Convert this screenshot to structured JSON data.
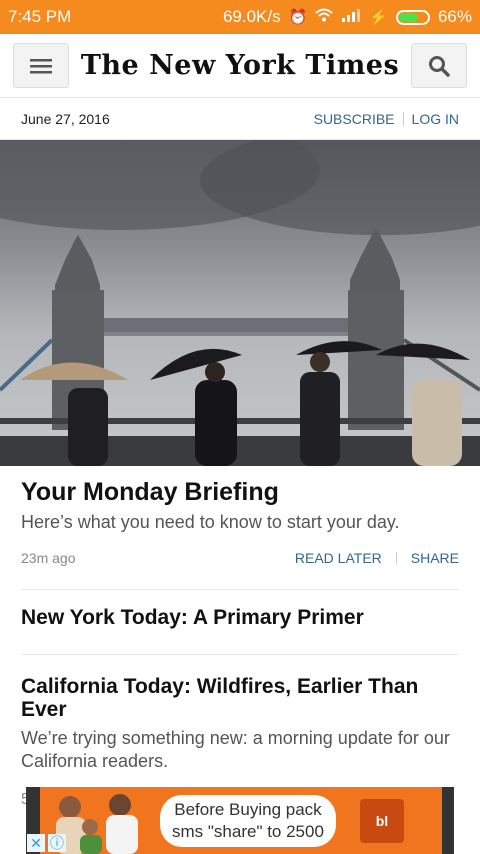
{
  "statusbar": {
    "time": "7:45 PM",
    "speed": "69.0K/s",
    "battery": "66%",
    "icons": [
      "alarm-icon",
      "wifi-icon",
      "signal-icon",
      "charging-icon"
    ]
  },
  "header": {
    "masthead": "The New York Times",
    "menu_icon": "hamburger-menu-icon",
    "search_icon": "search-icon"
  },
  "daterow": {
    "date": "June 27, 2016",
    "subscribe": "SUBSCRIBE",
    "login": "LOG IN"
  },
  "articles": [
    {
      "headline": "Your Monday Briefing",
      "summary": "Here’s what you need to know to start your day.",
      "time": "23m ago",
      "read_later": "READ LATER",
      "share": "SHARE"
    },
    {
      "headline": "New York Today: A Primary Primer"
    },
    {
      "headline": "California Today: Wildfires, Earlier Than Ever",
      "summary": "We’re trying something new: a morning update for our California readers.",
      "partial_time": "5"
    }
  ],
  "ad": {
    "line1": "Before Buying pack",
    "line2": "sms \"share\" to 2500",
    "logo_text": "bl",
    "close_icon": "ad-close-icon",
    "info_icon": "ad-info-icon"
  },
  "colors": {
    "statusbar": "#f58a1f",
    "link": "#326891",
    "ad": "#f1751f"
  }
}
